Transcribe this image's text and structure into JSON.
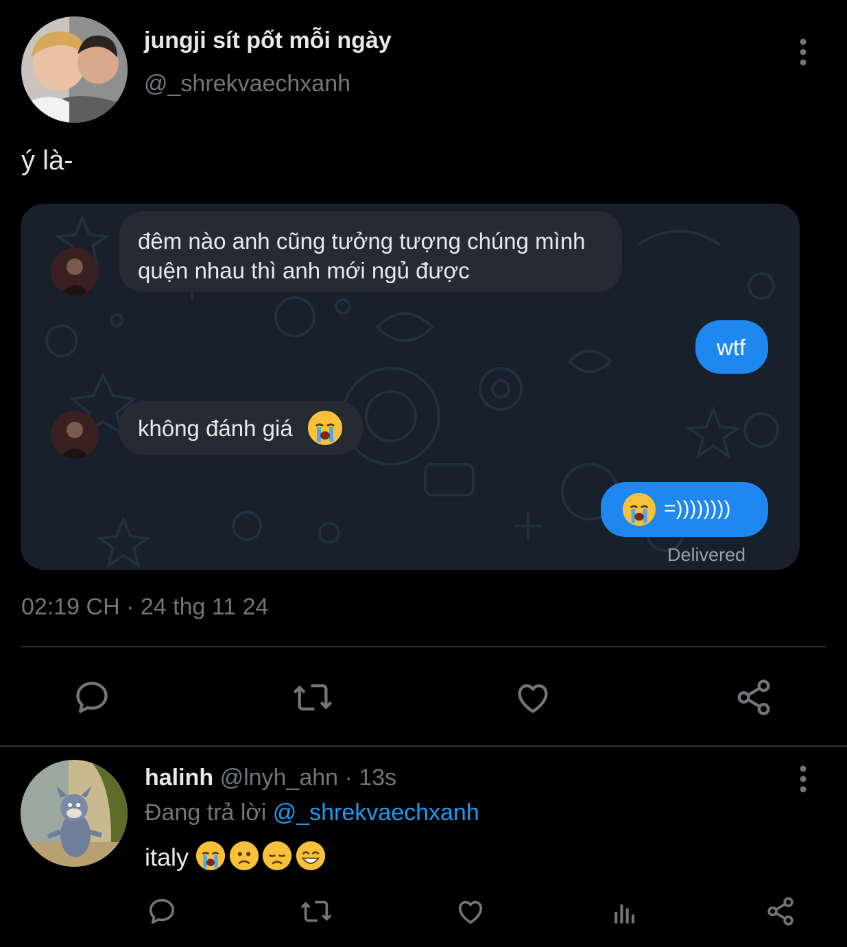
{
  "tweet": {
    "display_name": "jungji sít pốt mỗi ngày",
    "handle": "@_shrekvaechxanh",
    "text": "ý là-",
    "timestamp": "02:19 CH · 24 thg 11 24"
  },
  "chat": {
    "messages": [
      {
        "side": "in",
        "line1": "đêm nào anh cũng tưởng tượng chúng mình",
        "line2": "quện nhau thì anh mới ngủ được"
      },
      {
        "side": "out",
        "text": "wtf"
      },
      {
        "side": "in",
        "text": "không đánh giá"
      },
      {
        "side": "out",
        "text": "=))))))))"
      }
    ],
    "status": "Delivered"
  },
  "reply": {
    "display_name": "halinh",
    "handle": "@lnyh_ahn",
    "time": "· 13s",
    "replying_prefix": "Đang trả lời",
    "replying_to": "@_shrekvaechxanh",
    "text": "italy"
  },
  "colors": {
    "background": "#000000",
    "chat_bg": "#17202b",
    "bubble_in": "#262a32",
    "bubble_out": "#1e88f0",
    "link": "#1d9bf0",
    "muted": "#71767b"
  },
  "icons": [
    "more-vertical-icon",
    "reply-icon",
    "retweet-icon",
    "like-icon",
    "share-icon",
    "analytics-icon",
    "crying-face-emoji",
    "worried-face-emoji",
    "disappointed-face-emoji",
    "grinning-face-emoji"
  ]
}
